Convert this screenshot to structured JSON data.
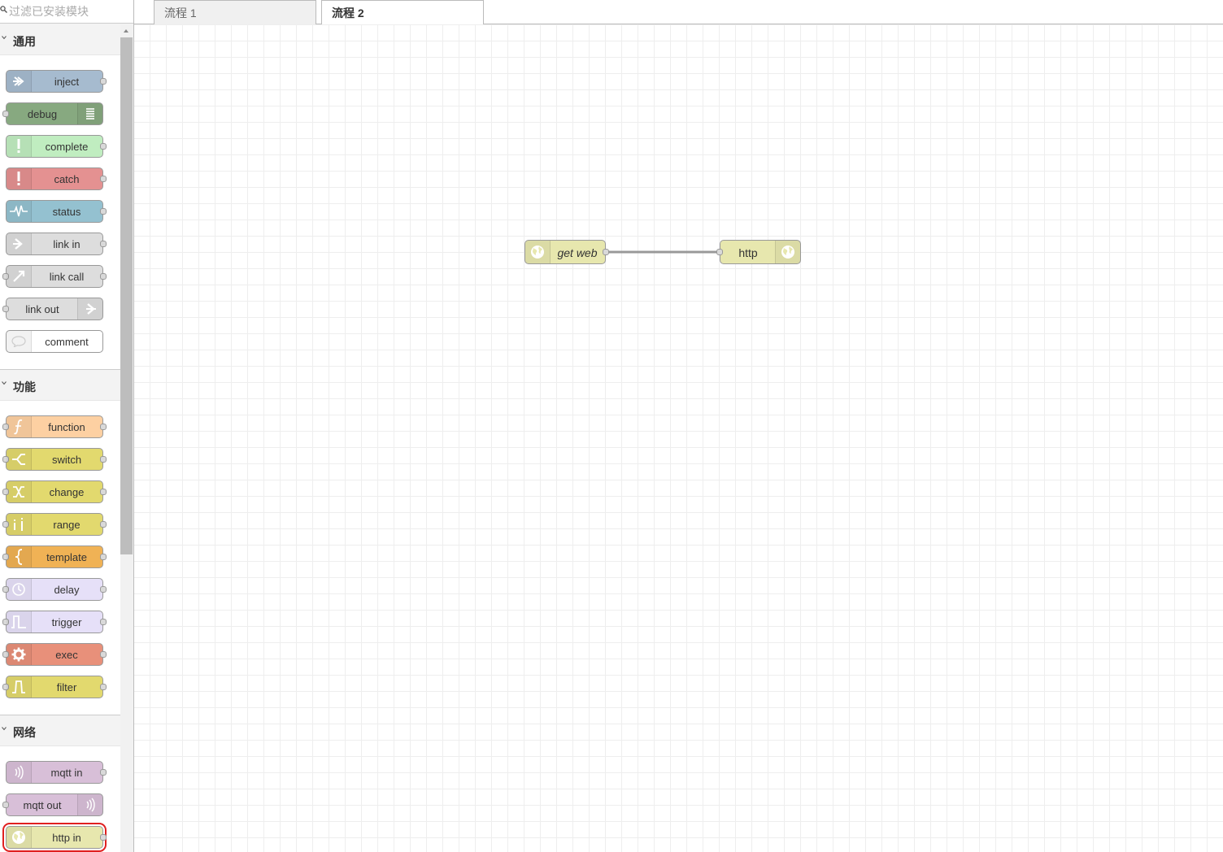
{
  "palette": {
    "search_placeholder": "过滤已安装模块",
    "categories": [
      {
        "title": "通用",
        "nodes": [
          {
            "label": "inject",
            "color": "#a6bbcf",
            "icon": "arrow-in-icon"
          },
          {
            "label": "debug",
            "color": "#87a980",
            "icon": "list-icon"
          },
          {
            "label": "complete",
            "color": "#c0edc0",
            "icon": "exclamation-icon"
          },
          {
            "label": "catch",
            "color": "#e49191",
            "icon": "exclamation-icon"
          },
          {
            "label": "status",
            "color": "#94c1d0",
            "icon": "pulse-icon"
          },
          {
            "label": "link in",
            "color": "#dddddd",
            "icon": "link-in-icon"
          },
          {
            "label": "link call",
            "color": "#dddddd",
            "icon": "link-call-icon"
          },
          {
            "label": "link out",
            "color": "#dddddd",
            "icon": "link-out-icon"
          },
          {
            "label": "comment",
            "color": "#ffffff",
            "icon": "speech-bubble-icon"
          }
        ]
      },
      {
        "title": "功能",
        "nodes": [
          {
            "label": "function",
            "color": "#fdd0a2",
            "icon": "function-icon"
          },
          {
            "label": "switch",
            "color": "#e2d96e",
            "icon": "switch-icon"
          },
          {
            "label": "change",
            "color": "#e2d96e",
            "icon": "shuffle-icon"
          },
          {
            "label": "range",
            "color": "#e2d96e",
            "icon": "range-icon"
          },
          {
            "label": "template",
            "color": "#f0b255",
            "icon": "brace-icon"
          },
          {
            "label": "delay",
            "color": "#e6e0f8",
            "icon": "timer-icon"
          },
          {
            "label": "trigger",
            "color": "#e6e0f8",
            "icon": "trigger-icon"
          },
          {
            "label": "exec",
            "color": "#e8907a",
            "icon": "cog-icon"
          },
          {
            "label": "filter",
            "color": "#e2d96e",
            "icon": "filter-icon"
          }
        ]
      },
      {
        "title": "网络",
        "nodes": [
          {
            "label": "mqtt in",
            "color": "#d8bfd8",
            "icon": "bridge-icon"
          },
          {
            "label": "mqtt out",
            "color": "#d8bfd8",
            "icon": "bridge-icon"
          },
          {
            "label": "http in",
            "color": "#e7e7ae",
            "icon": "globe-icon"
          }
        ]
      }
    ]
  },
  "tabs": [
    {
      "label": "流程 1"
    },
    {
      "label": "流程 2",
      "active": true
    }
  ],
  "flow": {
    "nodes": [
      {
        "label": "get web",
        "italic": true
      },
      {
        "label": "http"
      }
    ]
  }
}
